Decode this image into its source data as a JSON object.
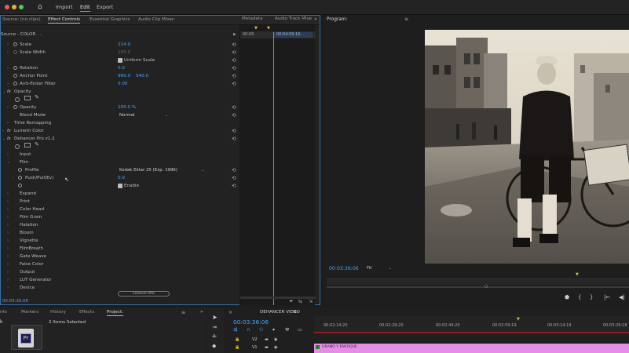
{
  "topbar": {
    "nav": {
      "import": "Import",
      "edit": "Edit",
      "export": "Export"
    }
  },
  "effect_controls": {
    "tabs": [
      "Source: (no clips)",
      "Effect Controls",
      "Essential Graphics",
      "Audio Clip Mixer:"
    ],
    "source_label": "Source - COLOR",
    "rows": {
      "scale": "Scale",
      "scale_value": "214.0",
      "scale_width": "Scale Width",
      "scale_width_value": "100.0",
      "uniform_scale": "Uniform Scale",
      "rotation": "Rotation",
      "rotation_value": "0.0",
      "anchor_point": "Anchor Point",
      "anchor_x": "960.0",
      "anchor_y": "540.0",
      "anti_flicker": "Anti-flicker Filter",
      "anti_flicker_value": "0.00",
      "opacity_section": "Opacity",
      "opacity": "Opacity",
      "opacity_value": "100.0 %",
      "blend_mode": "Blend Mode",
      "blend_mode_value": "Normal",
      "time_remapping": "Time Remapping",
      "lumetri_color": "Lumetri Color",
      "dehancer": "Dehancer Pro v1.2",
      "input": "Input",
      "film": "Film",
      "profile": "Profile",
      "profile_value": "Kodak Ektar 25 (Exp. 1996)",
      "push_pull": "Push/Pull(Ev)",
      "push_pull_value": "0.0",
      "enable": "Enable",
      "expand": "Expand",
      "print": "Print",
      "color_head": "Color Head",
      "film_grain": "Film Grain",
      "halation": "Halation",
      "bloom": "Bloom",
      "vignette": "Vignette",
      "filmbreath": "FilmBreath",
      "gate_weave": "Gate Weave",
      "false_color": "False Color",
      "output": "Output",
      "lut_generator": "LUT Generator",
      "device": "Device"
    },
    "license_button": "Licence Info",
    "timecode": "00:03:36:06",
    "mini_timeline": {
      "start": "00:00",
      "tc": "00:04:59:16"
    }
  },
  "metadata_tabs": [
    "Metadata",
    "Audio Track Mixe"
  ],
  "program": {
    "title": "Program:",
    "timecode": "00:03:36:06",
    "fit": "Fit"
  },
  "project_panel": {
    "tabs": [
      "nfo",
      "Markers",
      "History",
      "Effects",
      "Project:"
    ],
    "items_selected": "2 Items Selected",
    "icon_label": "Pr"
  },
  "sequence": {
    "name": "DEHANCER VIDEO",
    "timecode": "00:03:36:06",
    "ruler": [
      "00:02:14:20",
      "00:02:29:20",
      "00:02:44:20",
      "00:02:59:19",
      "00:03:14:19",
      "00:03:29:18"
    ],
    "track_v2": "V2",
    "track_v1": "V1",
    "clip_label": "GRANO Y ENFOQUE"
  },
  "colors": {
    "accent": "#4aa3ff",
    "panel": "#222222",
    "clip": "#e58ee6"
  }
}
